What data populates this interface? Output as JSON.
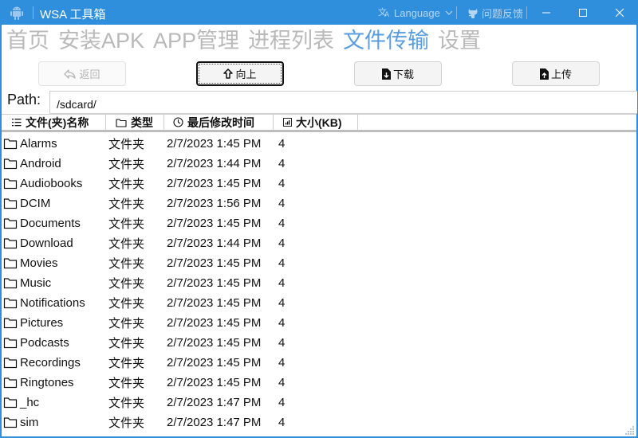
{
  "window": {
    "title": "WSA 工具箱",
    "language_label": "Language",
    "feedback_label": "问题反馈",
    "accent_color": "#2f8fdd"
  },
  "nav": {
    "items": [
      {
        "label": "首页",
        "active": false
      },
      {
        "label": "安装APK",
        "active": false
      },
      {
        "label": "APP管理",
        "active": false
      },
      {
        "label": "进程列表",
        "active": false
      },
      {
        "label": "文件传输",
        "active": true
      },
      {
        "label": "设置",
        "active": false
      }
    ]
  },
  "toolbar": {
    "back_label": "返回",
    "up_label": "向上",
    "download_label": "下载",
    "upload_label": "上传"
  },
  "path": {
    "label": "Path:",
    "value": "/sdcard/"
  },
  "table": {
    "columns": [
      {
        "label": "文件(夹)名称",
        "icon": "list-icon"
      },
      {
        "label": "类型",
        "icon": "folder-icon"
      },
      {
        "label": "最后修改时间",
        "icon": "clock-icon"
      },
      {
        "label": "大小(KB)",
        "icon": "chart-icon"
      }
    ],
    "rows": [
      {
        "name": "Alarms",
        "type": "文件夹",
        "modified": "2/7/2023 1:45 PM",
        "size": "4"
      },
      {
        "name": "Android",
        "type": "文件夹",
        "modified": "2/7/2023 1:44 PM",
        "size": "4"
      },
      {
        "name": "Audiobooks",
        "type": "文件夹",
        "modified": "2/7/2023 1:45 PM",
        "size": "4"
      },
      {
        "name": "DCIM",
        "type": "文件夹",
        "modified": "2/7/2023 1:56 PM",
        "size": "4"
      },
      {
        "name": "Documents",
        "type": "文件夹",
        "modified": "2/7/2023 1:45 PM",
        "size": "4"
      },
      {
        "name": "Download",
        "type": "文件夹",
        "modified": "2/7/2023 1:44 PM",
        "size": "4"
      },
      {
        "name": "Movies",
        "type": "文件夹",
        "modified": "2/7/2023 1:45 PM",
        "size": "4"
      },
      {
        "name": "Music",
        "type": "文件夹",
        "modified": "2/7/2023 1:45 PM",
        "size": "4"
      },
      {
        "name": "Notifications",
        "type": "文件夹",
        "modified": "2/7/2023 1:45 PM",
        "size": "4"
      },
      {
        "name": "Pictures",
        "type": "文件夹",
        "modified": "2/7/2023 1:45 PM",
        "size": "4"
      },
      {
        "name": "Podcasts",
        "type": "文件夹",
        "modified": "2/7/2023 1:45 PM",
        "size": "4"
      },
      {
        "name": "Recordings",
        "type": "文件夹",
        "modified": "2/7/2023 1:45 PM",
        "size": "4"
      },
      {
        "name": "Ringtones",
        "type": "文件夹",
        "modified": "2/7/2023 1:45 PM",
        "size": "4"
      },
      {
        "name": "_hc",
        "type": "文件夹",
        "modified": "2/7/2023 1:47 PM",
        "size": "4"
      },
      {
        "name": "sim",
        "type": "文件夹",
        "modified": "2/7/2023 1:47 PM",
        "size": "4"
      }
    ]
  }
}
